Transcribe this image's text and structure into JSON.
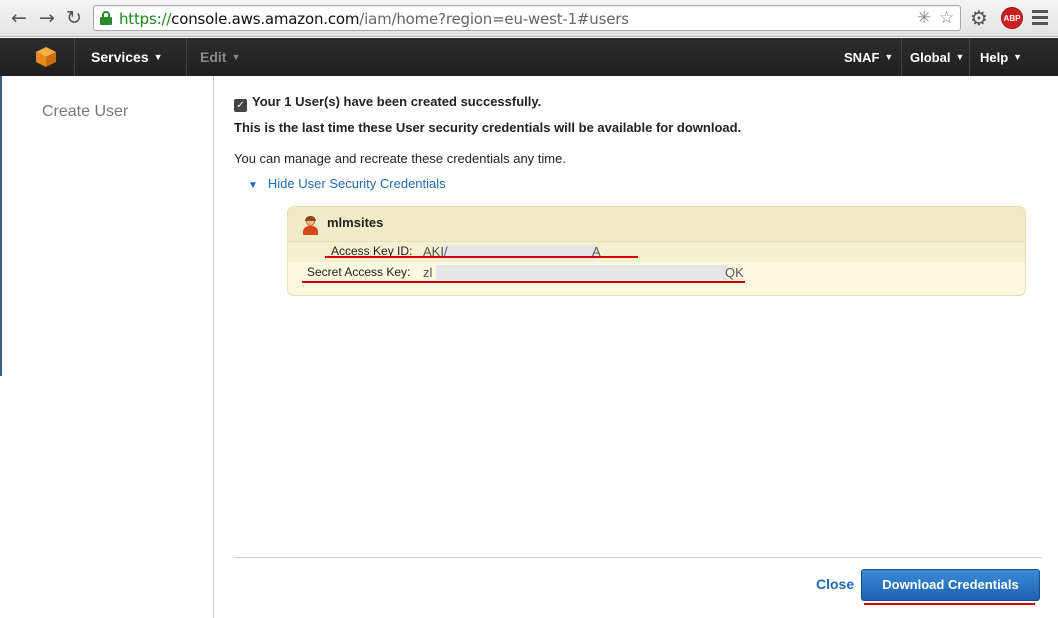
{
  "browser": {
    "url_scheme": "https://",
    "url_host": "console.aws.amazon.com",
    "url_path": "/iam/home?region=eu-west-1#users",
    "abp_label": "ABP"
  },
  "aws_header": {
    "services_label": "Services",
    "edit_label": "Edit",
    "account_label": "SNAF",
    "region_label": "Global",
    "help_label": "Help"
  },
  "sidebar": {
    "title": "Create User"
  },
  "main": {
    "success_message": "Your 1 User(s) have been created successfully.",
    "warning_message": "This is the last time these User security credentials will be available for download.",
    "manage_message": "You can manage and recreate these credentials any time.",
    "hide_credentials_label": "Hide User Security Credentials",
    "credentials": {
      "username": "mlmsites",
      "access_key_label": "Access Key ID:",
      "access_key_prefix": "AKI/",
      "access_key_suffix": "A",
      "secret_key_label": "Secret Access Key:",
      "secret_key_prefix": "zl",
      "secret_key_suffix": "QK"
    },
    "close_label": "Close",
    "download_label": "Download Credentials"
  },
  "colors": {
    "link": "#1e6bb8",
    "header_bg": "#232323",
    "annotation_red": "#d60000",
    "credential_box_bg": "#faf8df"
  }
}
